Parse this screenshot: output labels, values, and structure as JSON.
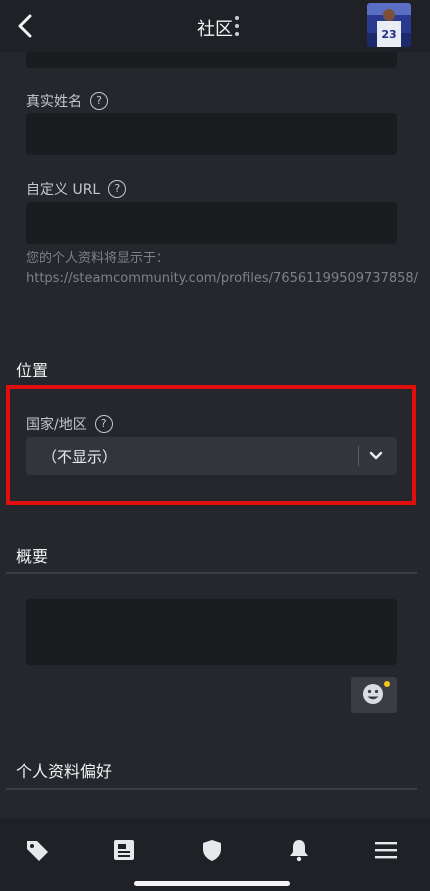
{
  "header": {
    "title": "社区"
  },
  "profile": {
    "real_name": {
      "label": "真实姓名",
      "value": ""
    },
    "custom_url": {
      "label": "自定义 URL",
      "value": ""
    },
    "url_hint_line1": "您的个人资料将显示于：",
    "url_hint_line2": "https://steamcommunity.com/profiles/76561199509737858/"
  },
  "location": {
    "section_title": "位置",
    "country_label": "国家/地区",
    "country_selected": "（不显示）"
  },
  "summary": {
    "section_title": "概要",
    "value": ""
  },
  "preferences": {
    "section_title": "个人资料偏好"
  },
  "avatar": {
    "jersey_number": "23"
  },
  "colors": {
    "highlight": "#e10e0e",
    "background": "#25272c",
    "input_bg": "#1a1c20",
    "notification_dot": "#f5c518"
  },
  "bottom_nav": [
    "tag-icon",
    "news-icon",
    "shield-icon",
    "bell-icon",
    "menu-icon"
  ]
}
